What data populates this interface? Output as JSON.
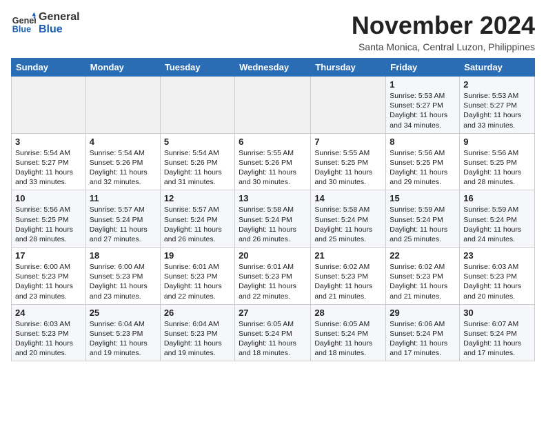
{
  "logo": {
    "line1": "General",
    "line2": "Blue"
  },
  "title": "November 2024",
  "subtitle": "Santa Monica, Central Luzon, Philippines",
  "weekdays": [
    "Sunday",
    "Monday",
    "Tuesday",
    "Wednesday",
    "Thursday",
    "Friday",
    "Saturday"
  ],
  "weeks": [
    [
      {
        "day": "",
        "info": ""
      },
      {
        "day": "",
        "info": ""
      },
      {
        "day": "",
        "info": ""
      },
      {
        "day": "",
        "info": ""
      },
      {
        "day": "",
        "info": ""
      },
      {
        "day": "1",
        "info": "Sunrise: 5:53 AM\nSunset: 5:27 PM\nDaylight: 11 hours\nand 34 minutes."
      },
      {
        "day": "2",
        "info": "Sunrise: 5:53 AM\nSunset: 5:27 PM\nDaylight: 11 hours\nand 33 minutes."
      }
    ],
    [
      {
        "day": "3",
        "info": "Sunrise: 5:54 AM\nSunset: 5:27 PM\nDaylight: 11 hours\nand 33 minutes."
      },
      {
        "day": "4",
        "info": "Sunrise: 5:54 AM\nSunset: 5:26 PM\nDaylight: 11 hours\nand 32 minutes."
      },
      {
        "day": "5",
        "info": "Sunrise: 5:54 AM\nSunset: 5:26 PM\nDaylight: 11 hours\nand 31 minutes."
      },
      {
        "day": "6",
        "info": "Sunrise: 5:55 AM\nSunset: 5:26 PM\nDaylight: 11 hours\nand 30 minutes."
      },
      {
        "day": "7",
        "info": "Sunrise: 5:55 AM\nSunset: 5:25 PM\nDaylight: 11 hours\nand 30 minutes."
      },
      {
        "day": "8",
        "info": "Sunrise: 5:56 AM\nSunset: 5:25 PM\nDaylight: 11 hours\nand 29 minutes."
      },
      {
        "day": "9",
        "info": "Sunrise: 5:56 AM\nSunset: 5:25 PM\nDaylight: 11 hours\nand 28 minutes."
      }
    ],
    [
      {
        "day": "10",
        "info": "Sunrise: 5:56 AM\nSunset: 5:25 PM\nDaylight: 11 hours\nand 28 minutes."
      },
      {
        "day": "11",
        "info": "Sunrise: 5:57 AM\nSunset: 5:24 PM\nDaylight: 11 hours\nand 27 minutes."
      },
      {
        "day": "12",
        "info": "Sunrise: 5:57 AM\nSunset: 5:24 PM\nDaylight: 11 hours\nand 26 minutes."
      },
      {
        "day": "13",
        "info": "Sunrise: 5:58 AM\nSunset: 5:24 PM\nDaylight: 11 hours\nand 26 minutes."
      },
      {
        "day": "14",
        "info": "Sunrise: 5:58 AM\nSunset: 5:24 PM\nDaylight: 11 hours\nand 25 minutes."
      },
      {
        "day": "15",
        "info": "Sunrise: 5:59 AM\nSunset: 5:24 PM\nDaylight: 11 hours\nand 25 minutes."
      },
      {
        "day": "16",
        "info": "Sunrise: 5:59 AM\nSunset: 5:24 PM\nDaylight: 11 hours\nand 24 minutes."
      }
    ],
    [
      {
        "day": "17",
        "info": "Sunrise: 6:00 AM\nSunset: 5:23 PM\nDaylight: 11 hours\nand 23 minutes."
      },
      {
        "day": "18",
        "info": "Sunrise: 6:00 AM\nSunset: 5:23 PM\nDaylight: 11 hours\nand 23 minutes."
      },
      {
        "day": "19",
        "info": "Sunrise: 6:01 AM\nSunset: 5:23 PM\nDaylight: 11 hours\nand 22 minutes."
      },
      {
        "day": "20",
        "info": "Sunrise: 6:01 AM\nSunset: 5:23 PM\nDaylight: 11 hours\nand 22 minutes."
      },
      {
        "day": "21",
        "info": "Sunrise: 6:02 AM\nSunset: 5:23 PM\nDaylight: 11 hours\nand 21 minutes."
      },
      {
        "day": "22",
        "info": "Sunrise: 6:02 AM\nSunset: 5:23 PM\nDaylight: 11 hours\nand 21 minutes."
      },
      {
        "day": "23",
        "info": "Sunrise: 6:03 AM\nSunset: 5:23 PM\nDaylight: 11 hours\nand 20 minutes."
      }
    ],
    [
      {
        "day": "24",
        "info": "Sunrise: 6:03 AM\nSunset: 5:23 PM\nDaylight: 11 hours\nand 20 minutes."
      },
      {
        "day": "25",
        "info": "Sunrise: 6:04 AM\nSunset: 5:23 PM\nDaylight: 11 hours\nand 19 minutes."
      },
      {
        "day": "26",
        "info": "Sunrise: 6:04 AM\nSunset: 5:23 PM\nDaylight: 11 hours\nand 19 minutes."
      },
      {
        "day": "27",
        "info": "Sunrise: 6:05 AM\nSunset: 5:24 PM\nDaylight: 11 hours\nand 18 minutes."
      },
      {
        "day": "28",
        "info": "Sunrise: 6:05 AM\nSunset: 5:24 PM\nDaylight: 11 hours\nand 18 minutes."
      },
      {
        "day": "29",
        "info": "Sunrise: 6:06 AM\nSunset: 5:24 PM\nDaylight: 11 hours\nand 17 minutes."
      },
      {
        "day": "30",
        "info": "Sunrise: 6:07 AM\nSunset: 5:24 PM\nDaylight: 11 hours\nand 17 minutes."
      }
    ]
  ]
}
